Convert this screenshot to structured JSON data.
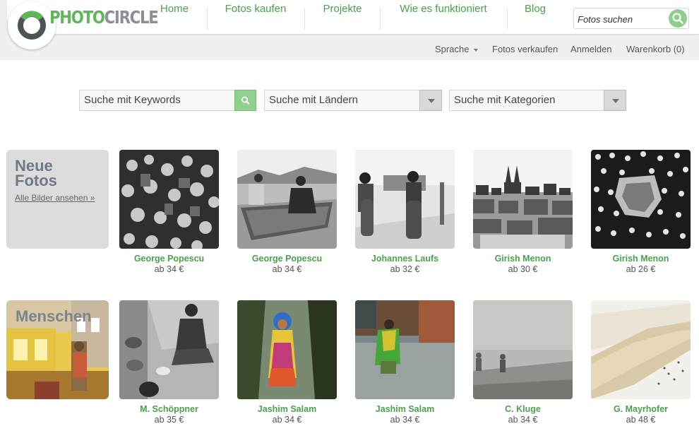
{
  "logo": {
    "part1": "PHOTO",
    "part2": "CIRCLE"
  },
  "nav": [
    {
      "label": "Home"
    },
    {
      "label": "Fotos kaufen"
    },
    {
      "label": "Projekte"
    },
    {
      "label": "Wie es funktioniert"
    },
    {
      "label": "Blog"
    }
  ],
  "top_search": {
    "placeholder": "Fotos suchen"
  },
  "subnav": {
    "language": "Sprache",
    "sell": "Fotos verkaufen",
    "login": "Anmelden",
    "cart": "Warenkorb (0)"
  },
  "filters": {
    "keywords": "Suche mit Keywords",
    "countries": "Suche mit Ländern",
    "categories": "Suche mit Kategorien"
  },
  "categories": {
    "new": {
      "title_line1": "Neue",
      "title_line2": "Fotos",
      "link": "Alle Bilder ansehen »"
    },
    "people": {
      "title": "Menschen"
    }
  },
  "photos_row1": [
    {
      "photographer": "George Popescu",
      "price": "ab 34 €"
    },
    {
      "photographer": "George Popescu",
      "price": "ab 34 €"
    },
    {
      "photographer": "Johannes Laufs",
      "price": "ab 32 €"
    },
    {
      "photographer": "Girish Menon",
      "price": "ab 30 €"
    },
    {
      "photographer": "Girish Menon",
      "price": "ab 26 €"
    }
  ],
  "photos_row2": [
    {
      "photographer": "M. Schöppner",
      "price": "ab 35 €"
    },
    {
      "photographer": "Jashim Salam",
      "price": "ab 34 €"
    },
    {
      "photographer": "Jashim Salam",
      "price": "ab 34 €"
    },
    {
      "photographer": "C. Kluge",
      "price": "ab 34 €"
    },
    {
      "photographer": "G. Mayrhofer",
      "price": "ab 48 €"
    }
  ],
  "colors": {
    "brand_green": "#4aa24a",
    "logo_green": "#5fb75a",
    "button_green": "#8dd08a",
    "logo_gray": "#8a9095"
  }
}
